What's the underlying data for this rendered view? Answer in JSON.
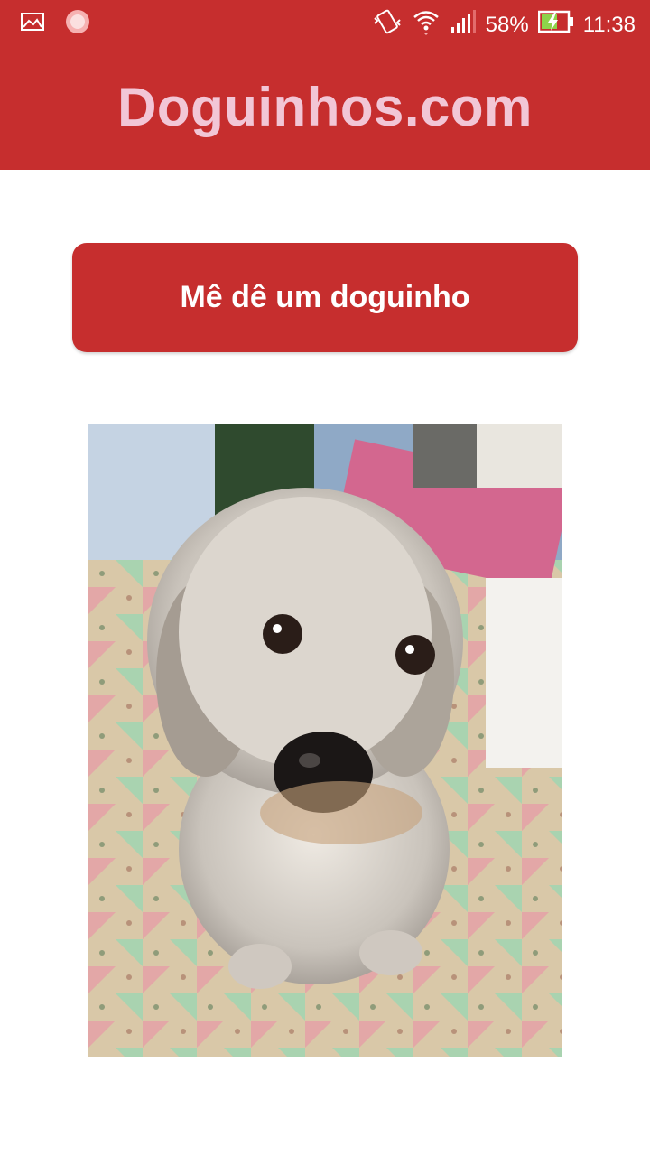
{
  "statusbar": {
    "battery_percent": "58%",
    "time": "11:38",
    "icons": [
      "gallery-icon",
      "app-notification-icon",
      "vibrate-icon",
      "wifi-icon",
      "signal-icon",
      "battery-charging-icon"
    ]
  },
  "appbar": {
    "title": "Doguinhos.com"
  },
  "main": {
    "button_label": "Mê dê um doguinho",
    "image_alt": "dog photo"
  },
  "colors": {
    "primary": "#c62e2e",
    "title_text": "#f2c6d6",
    "background": "#ffffff"
  }
}
